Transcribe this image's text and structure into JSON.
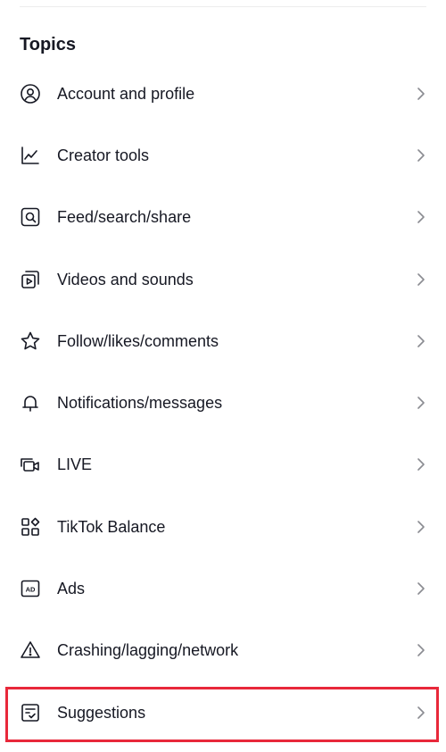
{
  "section": {
    "title": "Topics"
  },
  "topics": [
    {
      "label": "Account and profile",
      "icon": "account-icon"
    },
    {
      "label": "Creator tools",
      "icon": "chart-icon"
    },
    {
      "label": "Feed/search/share",
      "icon": "search-icon"
    },
    {
      "label": "Videos and sounds",
      "icon": "video-icon"
    },
    {
      "label": "Follow/likes/comments",
      "icon": "star-icon"
    },
    {
      "label": "Notifications/messages",
      "icon": "bell-icon"
    },
    {
      "label": "LIVE",
      "icon": "live-camera-icon"
    },
    {
      "label": "TikTok Balance",
      "icon": "balance-icon"
    },
    {
      "label": "Ads",
      "icon": "ad-icon"
    },
    {
      "label": "Crashing/lagging/network",
      "icon": "warning-icon"
    },
    {
      "label": "Suggestions",
      "icon": "suggestion-icon"
    }
  ],
  "highlight": {
    "color": "#e8283a",
    "target": "Suggestions"
  }
}
